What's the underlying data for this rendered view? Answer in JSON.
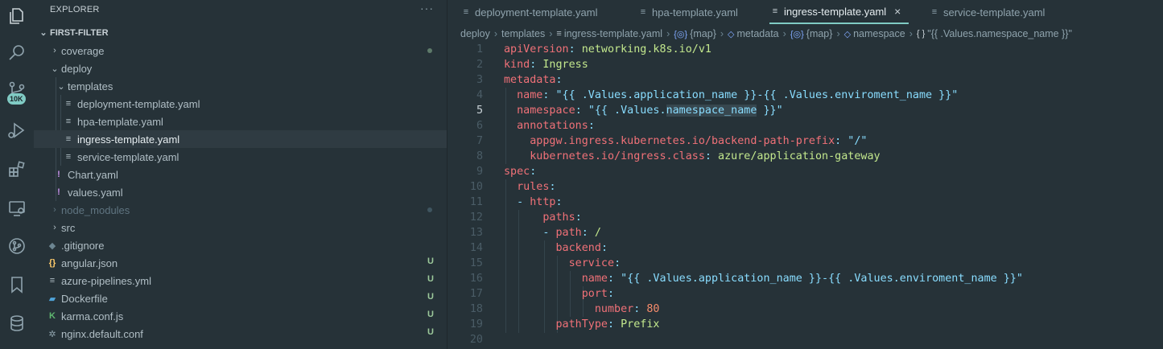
{
  "activity_bar": {
    "icons": [
      "explorer-icon",
      "search-icon",
      "source-control-icon",
      "run-debug-icon",
      "extensions-icon",
      "remote-explorer-icon",
      "git-graph-icon",
      "bookmarks-icon",
      "database-icon"
    ],
    "badge": "10K"
  },
  "sidebar": {
    "title": "EXPLORER",
    "more": "···",
    "folder": "FIRST-FILTER",
    "items": [
      {
        "label": "coverage",
        "type": "folder"
      },
      {
        "label": "deploy",
        "type": "folder"
      },
      {
        "label": "templates",
        "type": "folder"
      },
      {
        "label": "deployment-template.yaml",
        "type": "file"
      },
      {
        "label": "hpa-template.yaml",
        "type": "file"
      },
      {
        "label": "ingress-template.yaml",
        "type": "file"
      },
      {
        "label": "service-template.yaml",
        "type": "file"
      },
      {
        "label": "Chart.yaml",
        "type": "file"
      },
      {
        "label": "values.yaml",
        "type": "file"
      },
      {
        "label": "node_modules",
        "type": "folder"
      },
      {
        "label": "src",
        "type": "folder"
      },
      {
        "label": ".gitignore",
        "type": "file"
      },
      {
        "label": "angular.json",
        "type": "file",
        "status": "U"
      },
      {
        "label": "azure-pipelines.yml",
        "type": "file",
        "status": "U"
      },
      {
        "label": "Dockerfile",
        "type": "file",
        "status": "U"
      },
      {
        "label": "karma.conf.js",
        "type": "file",
        "status": "U"
      },
      {
        "label": "nginx.default.conf",
        "type": "file",
        "status": "U"
      }
    ]
  },
  "tabs": [
    {
      "label": "deployment-template.yaml",
      "active": false
    },
    {
      "label": "hpa-template.yaml",
      "active": false
    },
    {
      "label": "ingress-template.yaml",
      "active": true
    },
    {
      "label": "service-template.yaml",
      "active": false
    }
  ],
  "tab_close": "×",
  "breadcrumb": [
    "deploy",
    "templates",
    "ingress-template.yaml",
    "{map}",
    "metadata",
    "{map}",
    "namespace",
    "\"{{ .Values.namespace_name }}\""
  ],
  "breadcrumb_icons": {
    "map": "{◎}",
    "metadata": "◇",
    "namespace": "◇",
    "value": "{ }"
  },
  "code": {
    "current_line": 5,
    "lines": [
      [
        "1",
        [
          {
            "t": "apiVersion",
            "c": "k"
          },
          {
            "t": ": ",
            "c": "p"
          },
          {
            "t": "networking.k8s.io/v1",
            "c": "s"
          }
        ]
      ],
      [
        "2",
        [
          {
            "t": "kind",
            "c": "k"
          },
          {
            "t": ": ",
            "c": "p"
          },
          {
            "t": "Ingress",
            "c": "s"
          }
        ]
      ],
      [
        "3",
        [
          {
            "t": "metadata",
            "c": "k"
          },
          {
            "t": ":",
            "c": "p"
          }
        ]
      ],
      [
        "4",
        [
          {
            "t": "  name",
            "c": "k"
          },
          {
            "t": ": ",
            "c": "p"
          },
          {
            "t": "\"{{ .Values.application_name }}-{{ .Values.enviroment_name }}\"",
            "c": "p"
          }
        ]
      ],
      [
        "5",
        [
          {
            "t": "  namespace",
            "c": "k"
          },
          {
            "t": ": ",
            "c": "p"
          },
          {
            "t": "\"{{ .Values.",
            "c": "p"
          },
          {
            "t": "namespace_name",
            "c": "p hl"
          },
          {
            "t": " }}\"",
            "c": "p"
          }
        ]
      ],
      [
        "6",
        [
          {
            "t": "  annotations",
            "c": "k"
          },
          {
            "t": ":",
            "c": "p"
          }
        ]
      ],
      [
        "7",
        [
          {
            "t": "    appgw.ingress.kubernetes.io/backend-path-prefix",
            "c": "k"
          },
          {
            "t": ": ",
            "c": "p"
          },
          {
            "t": "\"/\"",
            "c": "p"
          }
        ]
      ],
      [
        "8",
        [
          {
            "t": "    kubernetes.io/ingress.class",
            "c": "k"
          },
          {
            "t": ": ",
            "c": "p"
          },
          {
            "t": "azure/application-gateway",
            "c": "s"
          }
        ]
      ],
      [
        "9",
        [
          {
            "t": "spec",
            "c": "k"
          },
          {
            "t": ":",
            "c": "p"
          }
        ]
      ],
      [
        "10",
        [
          {
            "t": "  rules",
            "c": "k"
          },
          {
            "t": ":",
            "c": "p"
          }
        ]
      ],
      [
        "11",
        [
          {
            "t": "  - ",
            "c": "p"
          },
          {
            "t": "http",
            "c": "k"
          },
          {
            "t": ":",
            "c": "p"
          }
        ]
      ],
      [
        "12",
        [
          {
            "t": "      paths",
            "c": "k"
          },
          {
            "t": ":",
            "c": "p"
          }
        ]
      ],
      [
        "13",
        [
          {
            "t": "      - ",
            "c": "p"
          },
          {
            "t": "path",
            "c": "k"
          },
          {
            "t": ": ",
            "c": "p"
          },
          {
            "t": "/",
            "c": "s"
          }
        ]
      ],
      [
        "14",
        [
          {
            "t": "        backend",
            "c": "k"
          },
          {
            "t": ":",
            "c": "p"
          }
        ]
      ],
      [
        "15",
        [
          {
            "t": "          service",
            "c": "k"
          },
          {
            "t": ":",
            "c": "p"
          }
        ]
      ],
      [
        "16",
        [
          {
            "t": "            name",
            "c": "k"
          },
          {
            "t": ": ",
            "c": "p"
          },
          {
            "t": "\"{{ .Values.application_name }}-{{ .Values.enviroment_name }}\"",
            "c": "p"
          }
        ]
      ],
      [
        "17",
        [
          {
            "t": "            port",
            "c": "k"
          },
          {
            "t": ":",
            "c": "p"
          }
        ]
      ],
      [
        "18",
        [
          {
            "t": "              number",
            "c": "k"
          },
          {
            "t": ": ",
            "c": "p"
          },
          {
            "t": "80",
            "c": "n"
          }
        ]
      ],
      [
        "19",
        [
          {
            "t": "        pathType",
            "c": "k"
          },
          {
            "t": ": ",
            "c": "p"
          },
          {
            "t": "Prefix",
            "c": "s"
          }
        ]
      ],
      [
        "20",
        []
      ]
    ]
  },
  "colors": {
    "background": "#263238",
    "accent": "#80cbc4",
    "key": "#f07178",
    "string": "#c3e88d",
    "punct": "#89ddff",
    "number": "#f78c6c",
    "untracked": "#9cc99b"
  }
}
